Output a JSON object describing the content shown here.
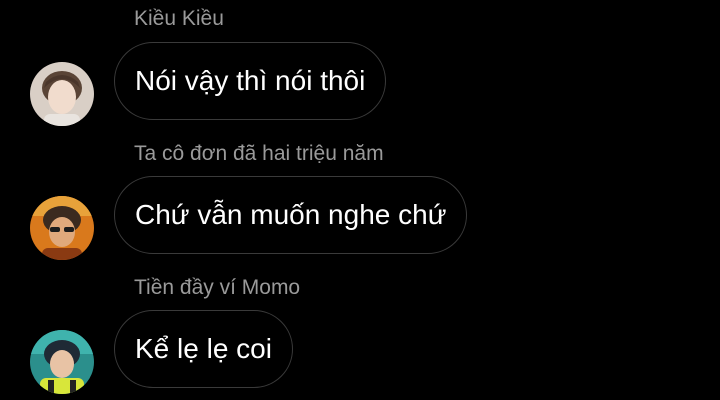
{
  "messages": [
    {
      "sender": "Kiều Kiều",
      "text": "Nói vậy thì nói thôi",
      "avatar": "avatar-light"
    },
    {
      "sender": "Ta cô đơn đã hai triệu năm",
      "text": "Chứ vẫn muốn nghe chứ",
      "avatar": "avatar-orange"
    },
    {
      "sender": "Tiền đầy ví Momo",
      "text": "Kể lẹ lẹ coi",
      "avatar": "avatar-teal"
    }
  ],
  "colors": {
    "background": "#000000",
    "sender_text": "#9a9a9a",
    "bubble_border": "#3a3a3a",
    "message_text": "#ffffff"
  }
}
